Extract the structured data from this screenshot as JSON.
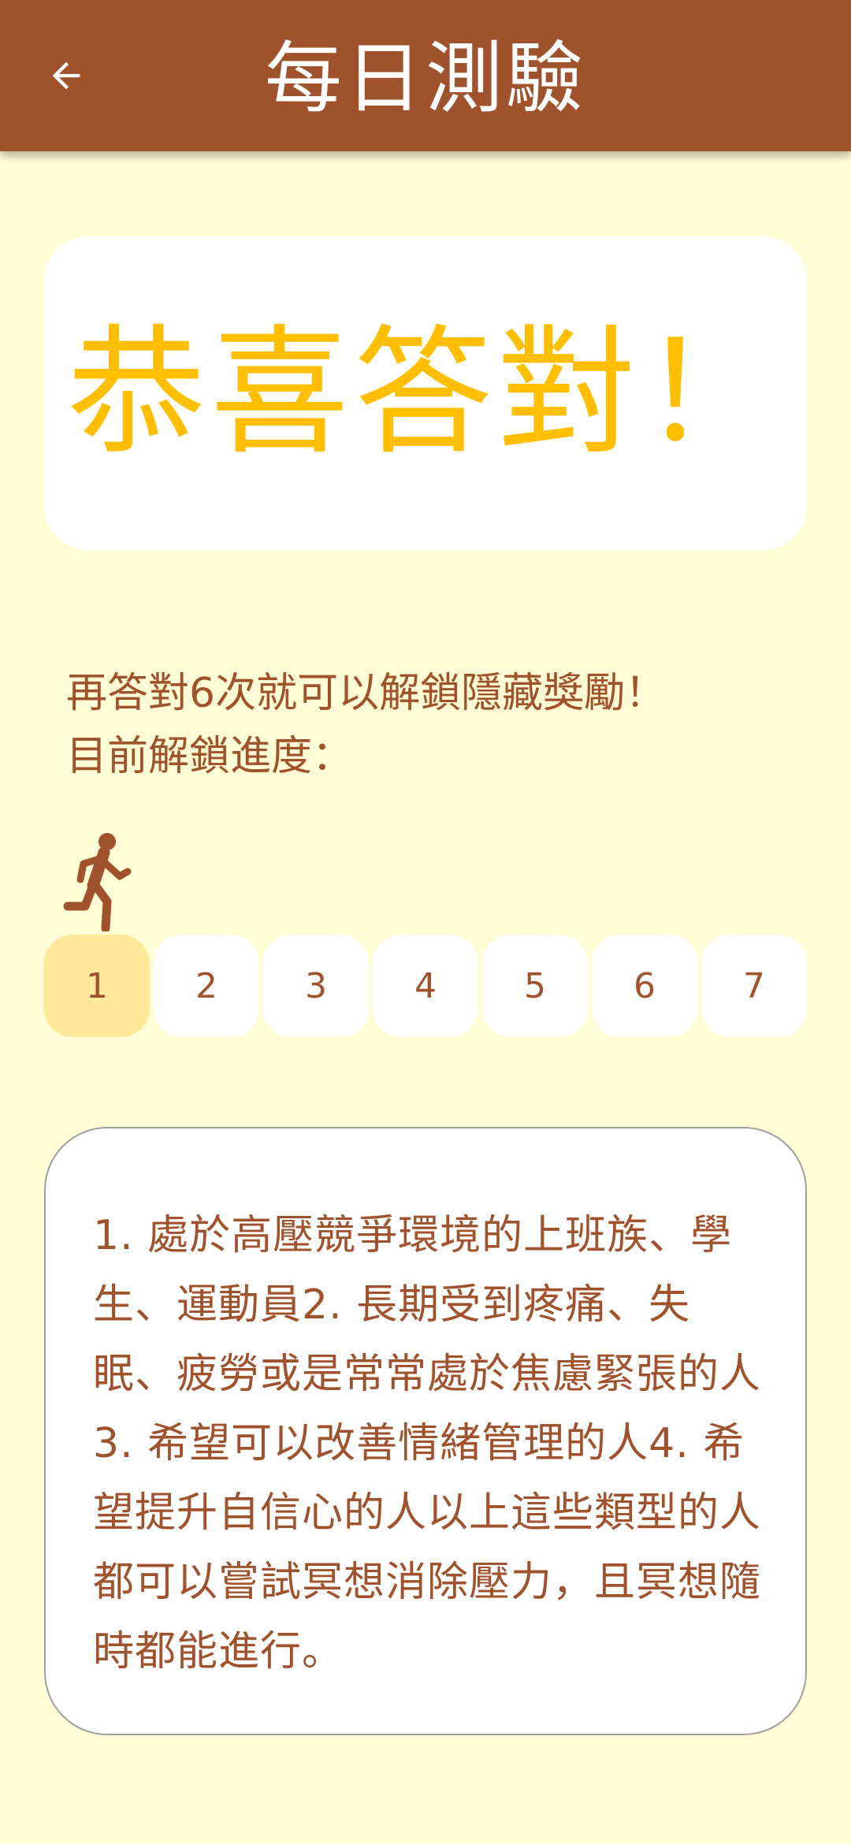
{
  "app_bar": {
    "title": "每日測驗",
    "back_icon": "arrow-left-icon"
  },
  "result": {
    "message": "恭喜答對！"
  },
  "progress": {
    "line1": "再答對6次就可以解鎖隱藏獎勵！",
    "line2": "目前解鎖進度：",
    "runner_icon": "running-person-icon",
    "current_step": 1,
    "steps": [
      "1",
      "2",
      "3",
      "4",
      "5",
      "6",
      "7"
    ]
  },
  "description": {
    "text": "1. 處於高壓競爭環境的上班族、學生、運動員2. 長期受到疼痛、失眠、疲勞或是常常處於焦慮緊張的人3. 希望可以改善情緒管理的人4. 希望提升自信心的人以上這些類型的人都可以嘗試冥想消除壓力，且冥想隨時都能進行。"
  },
  "colors": {
    "app_bar": "#A0522D",
    "background": "#FFFDD6",
    "accent_text": "#FFBE00",
    "active_step": "#FFE89A"
  }
}
